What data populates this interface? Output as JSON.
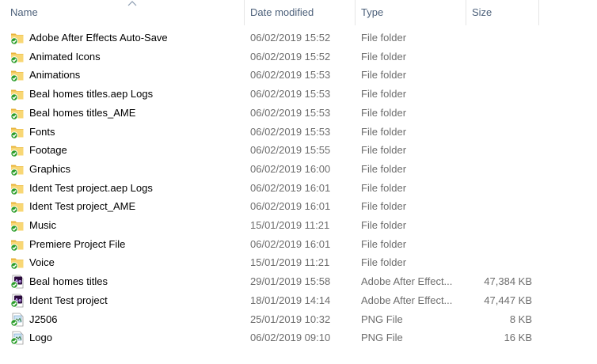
{
  "columns": {
    "name": "Name",
    "date": "Date modified",
    "type": "Type",
    "size": "Size"
  },
  "colors": {
    "folder": "#f5c84b",
    "sync_check": "#2a9d2a",
    "ae_purple": "#2b0a3d",
    "header_text": "#4c607a"
  },
  "files": [
    {
      "name": "Adobe After Effects Auto-Save",
      "date": "06/02/2019 15:52",
      "type": "File folder",
      "size": "",
      "icon": "folder-icon"
    },
    {
      "name": "Animated Icons",
      "date": "06/02/2019 15:52",
      "type": "File folder",
      "size": "",
      "icon": "folder-icon"
    },
    {
      "name": "Animations",
      "date": "06/02/2019 15:53",
      "type": "File folder",
      "size": "",
      "icon": "folder-icon"
    },
    {
      "name": "Beal homes titles.aep Logs",
      "date": "06/02/2019 15:53",
      "type": "File folder",
      "size": "",
      "icon": "folder-icon"
    },
    {
      "name": "Beal homes titles_AME",
      "date": "06/02/2019 15:53",
      "type": "File folder",
      "size": "",
      "icon": "folder-icon"
    },
    {
      "name": "Fonts",
      "date": "06/02/2019 15:53",
      "type": "File folder",
      "size": "",
      "icon": "folder-icon"
    },
    {
      "name": "Footage",
      "date": "06/02/2019 15:55",
      "type": "File folder",
      "size": "",
      "icon": "folder-icon"
    },
    {
      "name": "Graphics",
      "date": "06/02/2019 16:00",
      "type": "File folder",
      "size": "",
      "icon": "folder-icon"
    },
    {
      "name": "Ident Test project.aep Logs",
      "date": "06/02/2019 16:01",
      "type": "File folder",
      "size": "",
      "icon": "folder-icon"
    },
    {
      "name": "Ident Test project_AME",
      "date": "06/02/2019 16:01",
      "type": "File folder",
      "size": "",
      "icon": "folder-icon"
    },
    {
      "name": "Music",
      "date": "15/01/2019 11:21",
      "type": "File folder",
      "size": "",
      "icon": "folder-icon"
    },
    {
      "name": "Premiere Project File",
      "date": "06/02/2019 16:01",
      "type": "File folder",
      "size": "",
      "icon": "folder-icon"
    },
    {
      "name": "Voice",
      "date": "15/01/2019 11:21",
      "type": "File folder",
      "size": "",
      "icon": "folder-icon"
    },
    {
      "name": "Beal homes titles",
      "date": "29/01/2019 15:58",
      "type": "Adobe After Effect...",
      "size": "47,384 KB",
      "icon": "after-effects-project-icon"
    },
    {
      "name": "Ident Test project",
      "date": "18/01/2019 14:14",
      "type": "Adobe After Effect...",
      "size": "47,447 KB",
      "icon": "after-effects-project-icon"
    },
    {
      "name": "J2506",
      "date": "25/01/2019 10:32",
      "type": "PNG File",
      "size": "8 KB",
      "icon": "png-image-icon"
    },
    {
      "name": "Logo",
      "date": "06/02/2019 09:10",
      "type": "PNG File",
      "size": "16 KB",
      "icon": "png-image-icon"
    }
  ]
}
